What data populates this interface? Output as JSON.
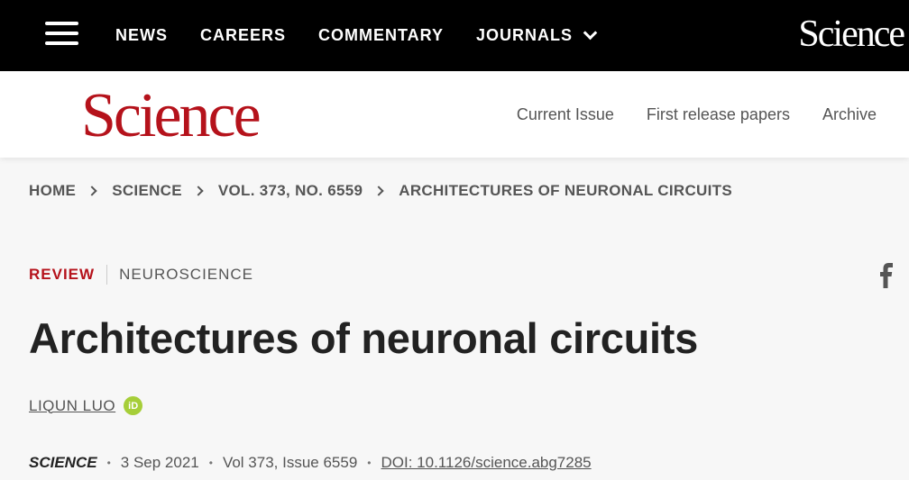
{
  "topbar": {
    "nav": [
      {
        "label": "NEWS"
      },
      {
        "label": "CAREERS"
      },
      {
        "label": "COMMENTARY"
      },
      {
        "label": "JOURNALS"
      }
    ],
    "brand": "Science"
  },
  "subheader": {
    "logo": "Science",
    "nav": [
      {
        "label": "Current Issue"
      },
      {
        "label": "First release papers"
      },
      {
        "label": "Archive"
      }
    ]
  },
  "breadcrumb": [
    {
      "label": "HOME"
    },
    {
      "label": "SCIENCE"
    },
    {
      "label": "VOL. 373, NO. 6559"
    },
    {
      "label": "ARCHITECTURES OF NEURONAL CIRCUITS"
    }
  ],
  "article": {
    "type": "REVIEW",
    "subject": "NEUROSCIENCE",
    "title": "Architectures of neuronal circuits",
    "author": "LIQUN LUO",
    "orcid_badge": "iD",
    "journal": "SCIENCE",
    "date": "3 Sep 2021",
    "volume_issue": "Vol 373, Issue 6559",
    "doi": "DOI: 10.1126/science.abg7285"
  },
  "icons": {
    "menu": "hamburger-menu-icon",
    "journals_dropdown": "chevron-down-icon",
    "share": "facebook-icon",
    "orcid": "orcid-icon"
  },
  "colors": {
    "brand_red": "#b5121b",
    "topbar_bg": "#000000",
    "orcid_green": "#a6ce39"
  }
}
